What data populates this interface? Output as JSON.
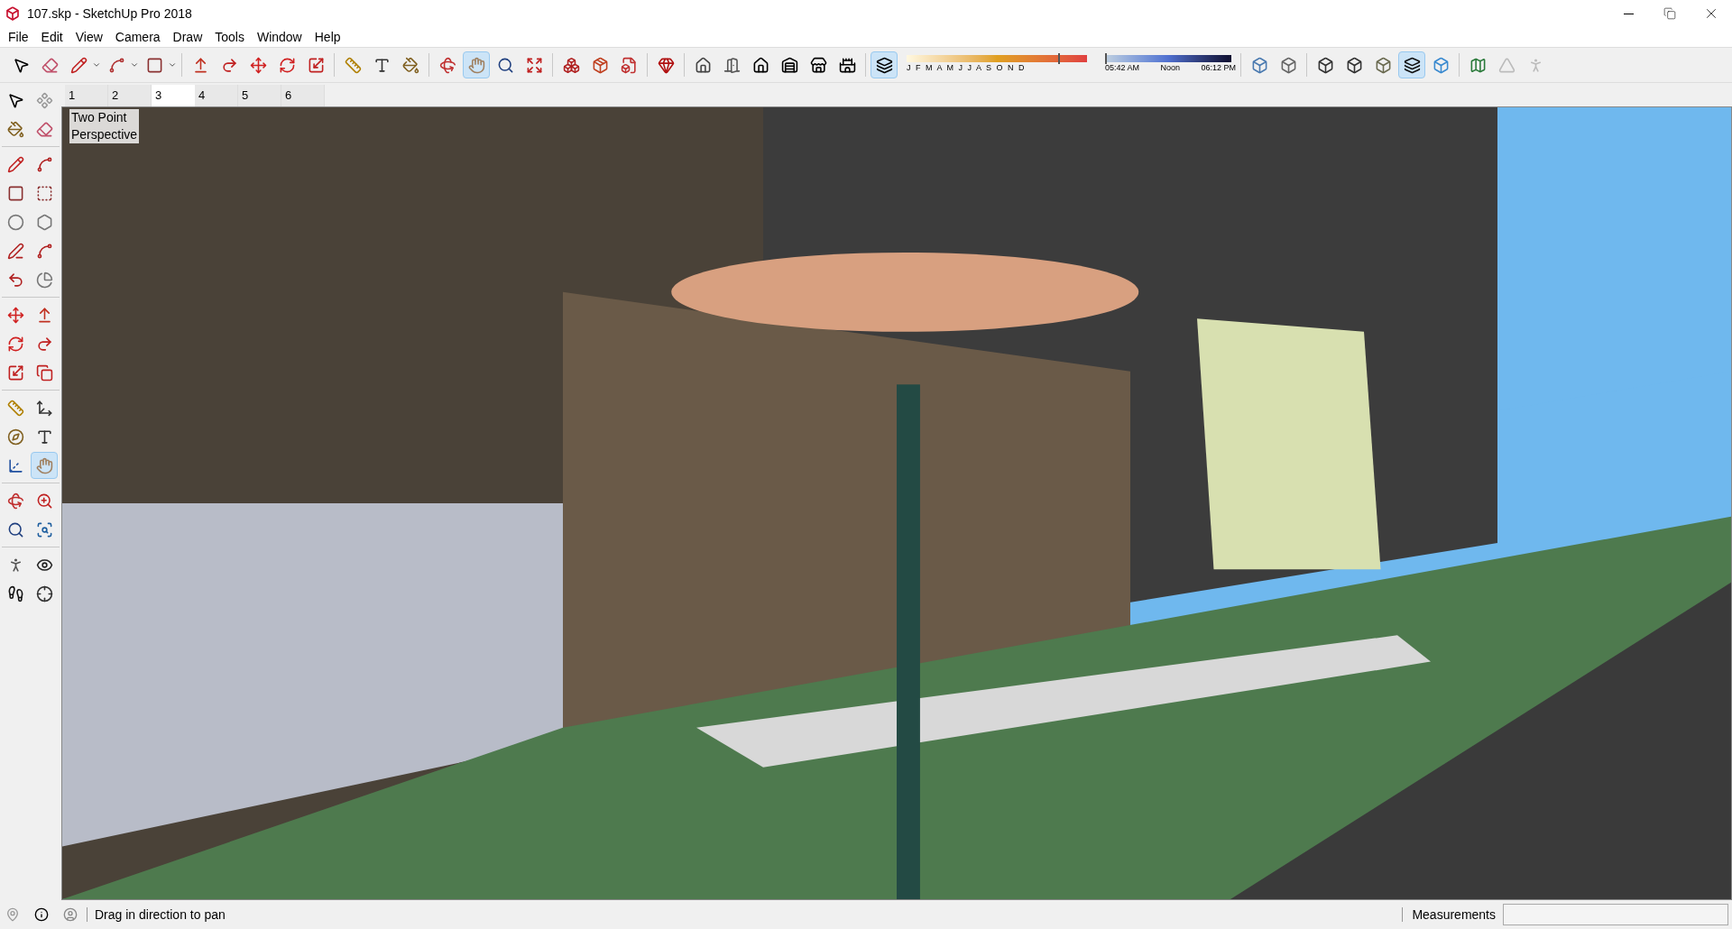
{
  "window": {
    "title": "107.skp - SketchUp Pro 2018"
  },
  "menu": [
    "File",
    "Edit",
    "View",
    "Camera",
    "Draw",
    "Tools",
    "Window",
    "Help"
  ],
  "main_toolbar": [
    {
      "selected": false
    },
    {
      "selected": false
    },
    {
      "selected": false
    },
    {
      "selected": false
    },
    {
      "selected": false
    },
    {
      "selected": false
    },
    {
      "selected": false
    },
    {
      "selected": false
    },
    {
      "selected": false
    },
    {
      "selected": false
    },
    {
      "selected": false
    },
    {
      "selected": false
    },
    {
      "selected": false
    },
    {
      "selected": false
    },
    {
      "selected": true
    },
    {
      "selected": false
    },
    {
      "selected": false
    },
    {
      "selected": false
    },
    {
      "selected": false
    },
    {
      "selected": false
    },
    {
      "selected": false
    },
    {
      "selected": false
    },
    {
      "selected": false
    },
    {
      "selected": false
    },
    {
      "selected": false
    },
    {
      "selected": false
    },
    {
      "selected": false
    },
    {
      "selected": true
    }
  ],
  "shadows": {
    "months": "J F M A M J J A S O N D",
    "date_slider": {
      "level": 0.84
    },
    "time_start": "05:42 AM",
    "time_mid": "Noon",
    "time_end": "06:12 PM",
    "time_slider": {
      "level": 0.0
    }
  },
  "style_toolbar": [
    {
      "selected": false
    },
    {
      "selected": false
    },
    {
      "selected": false
    },
    {
      "selected": false
    },
    {
      "selected": false
    },
    {
      "selected": true
    },
    {
      "selected": false
    },
    {
      "selected": false
    },
    {
      "selected": false
    },
    {
      "selected": false
    }
  ],
  "left_toolbar": [
    {
      "selected": false
    },
    {
      "selected": false
    },
    {
      "selected": false
    },
    {
      "selected": false
    },
    {
      "selected": false
    },
    {
      "selected": false
    },
    {
      "selected": false
    },
    {
      "selected": false
    },
    {
      "selected": false
    },
    {
      "selected": false
    },
    {
      "selected": false
    },
    {
      "selected": false
    },
    {
      "selected": false
    },
    {
      "selected": false
    },
    {
      "selected": false
    },
    {
      "selected": false
    },
    {
      "selected": false
    },
    {
      "selected": false
    },
    {
      "selected": false
    },
    {
      "selected": false
    },
    {
      "selected": false
    },
    {
      "selected": false
    },
    {
      "selected": false
    },
    {
      "selected": false
    },
    {
      "selected": false
    },
    {
      "selected": true
    },
    {
      "selected": false
    },
    {
      "selected": false
    },
    {
      "selected": false
    },
    {
      "selected": false
    },
    {
      "selected": false
    },
    {
      "selected": false
    },
    {
      "selected": false
    },
    {
      "selected": false
    }
  ],
  "scene_tabs": [
    {
      "label": "1",
      "selected": false
    },
    {
      "label": "2",
      "selected": false
    },
    {
      "label": "3",
      "selected": true
    },
    {
      "label": "4",
      "selected": false
    },
    {
      "label": "5",
      "selected": false
    },
    {
      "label": "6",
      "selected": false
    }
  ],
  "viewport": {
    "camera_label": "Two Point\nPerspective"
  },
  "status_bar": {
    "hint": "Drag in direction to pan",
    "measurements_label": "Measurements"
  }
}
